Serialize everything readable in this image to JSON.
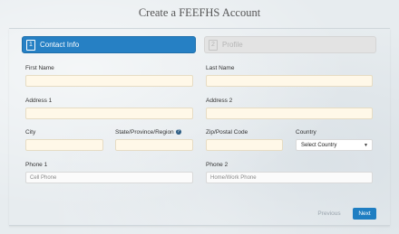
{
  "title": "Create a FEEFHS Account",
  "steps": [
    {
      "number": "1",
      "label": "Contact Info"
    },
    {
      "number": "2",
      "label": "Profile"
    }
  ],
  "form": {
    "first_name": {
      "label": "First Name",
      "value": ""
    },
    "last_name": {
      "label": "Last Name",
      "value": ""
    },
    "address1": {
      "label": "Address 1",
      "value": ""
    },
    "address2": {
      "label": "Address 2",
      "value": ""
    },
    "city": {
      "label": "City",
      "value": ""
    },
    "state": {
      "label": "State/Province/Region",
      "value": ""
    },
    "zip": {
      "label": "Zip/Postal Code",
      "value": ""
    },
    "country": {
      "label": "Country",
      "selected": "Select Country"
    },
    "phone1": {
      "label": "Phone 1",
      "placeholder": "Cell Phone"
    },
    "phone2": {
      "label": "Phone 2",
      "placeholder": "Home/Work Phone"
    }
  },
  "buttons": {
    "previous": "Previous",
    "next": "Next"
  },
  "colors": {
    "accent": "#2680c4",
    "required_field_bg": "#fff8e8"
  },
  "icons": {
    "help": "question-circle-icon",
    "dropdown": "caret-down-icon"
  }
}
